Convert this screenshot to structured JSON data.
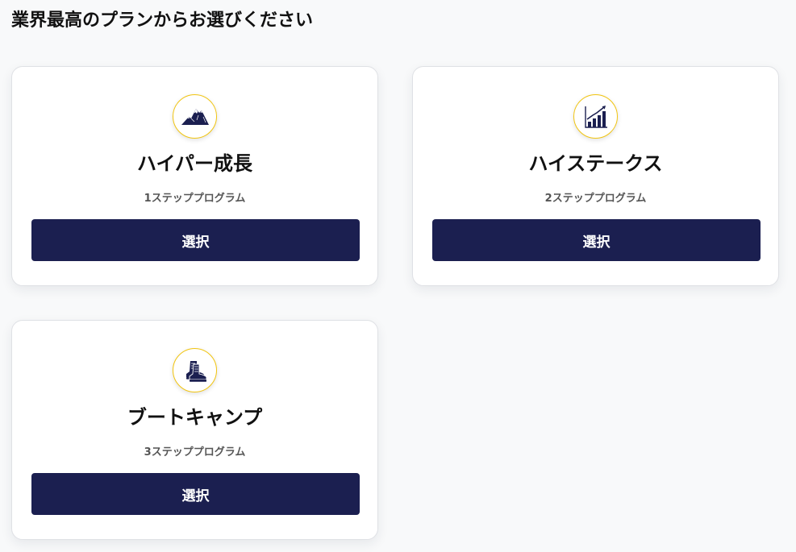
{
  "page": {
    "title": "業界最高のプランからお選びください"
  },
  "colors": {
    "background": "#f8f9fa",
    "card_background": "#ffffff",
    "button": "#1b1f50",
    "button_text": "#ffffff",
    "icon_ring": "#f1c40f",
    "icon_fill": "#1b1f50"
  },
  "plans": [
    {
      "icon": "mountain-icon",
      "title": "ハイパー成長",
      "subtitle": "1ステッププログラム",
      "button_label": "選択"
    },
    {
      "icon": "growth-chart-icon",
      "title": "ハイステークス",
      "subtitle": "2ステッププログラム",
      "button_label": "選択"
    },
    {
      "icon": "boots-icon",
      "title": "ブートキャンプ",
      "subtitle": "3ステッププログラム",
      "button_label": "選択"
    }
  ]
}
